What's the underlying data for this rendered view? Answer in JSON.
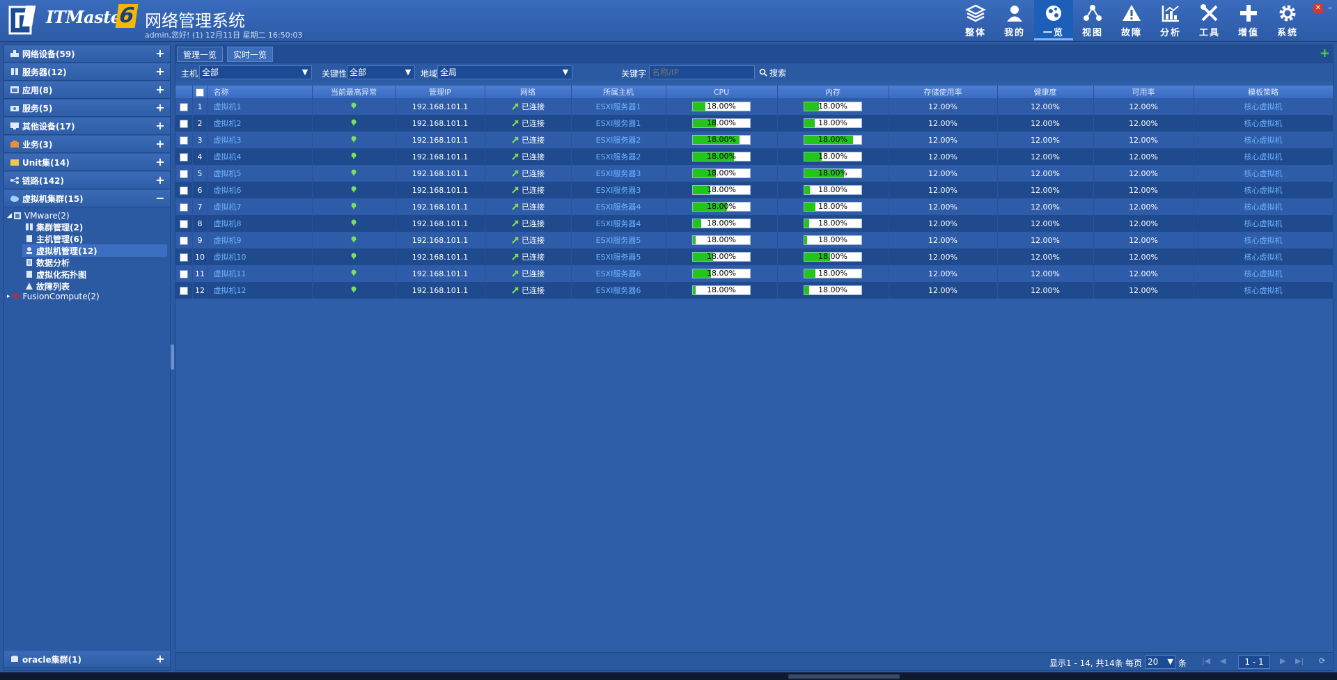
{
  "header": {
    "logo_text": "ITMaster",
    "logo_version": "6",
    "app_title": "网络管理系统",
    "welcome": "admin,您好! (1) 12月11日 星期二 16:50:03",
    "nav": [
      {
        "label": "整体",
        "icon": "layers-icon"
      },
      {
        "label": "我的",
        "icon": "user-icon"
      },
      {
        "label": "一览",
        "icon": "globe-icon",
        "active": true
      },
      {
        "label": "视图",
        "icon": "topology-icon"
      },
      {
        "label": "故障",
        "icon": "warning-icon"
      },
      {
        "label": "分析",
        "icon": "chart-icon"
      },
      {
        "label": "工具",
        "icon": "tools-icon"
      },
      {
        "label": "增值",
        "icon": "plus-icon"
      },
      {
        "label": "系统",
        "icon": "gear-icon"
      }
    ]
  },
  "sidebar": {
    "categories": [
      {
        "label": "网络设备(59)"
      },
      {
        "label": "服务器(12)"
      },
      {
        "label": "应用(8)"
      },
      {
        "label": "服务(5)"
      },
      {
        "label": "其他设备(17)"
      },
      {
        "label": "业务(3)"
      },
      {
        "label": "Unit集(14)"
      },
      {
        "label": "链路(142)"
      },
      {
        "label": "虚拟机集群(15)"
      }
    ],
    "tree": {
      "vmware": "VMware(2)",
      "children": [
        "集群管理(2)",
        "主机管理(6)",
        "虚拟机管理(12)",
        "数据分析",
        "虚拟化拓扑图",
        "故障列表"
      ],
      "fusion": "FusionCompute(2)"
    },
    "bottom_category": "oracle集群(1)"
  },
  "tabs": [
    "管理一览",
    "实时一览"
  ],
  "filters": {
    "host_label": "主机",
    "host_value": "全部",
    "key_label": "关键性",
    "key_value": "全部",
    "region_label": "地域",
    "region_value": "全局",
    "keyword_label": "关键字",
    "keyword_placeholder": "名称/IP",
    "search_label": "搜索"
  },
  "table": {
    "columns": [
      "名称",
      "当前最高异常",
      "管理IP",
      "网络",
      "所属主机",
      "CPU",
      "内存",
      "存储使用率",
      "健康度",
      "可用率",
      "模板策略"
    ],
    "rows": [
      {
        "no": "1",
        "name": "虚拟机1",
        "ip": "192.168.101.1",
        "net": "已连接",
        "host": "ESXI服务器1",
        "cpu": "18.00%",
        "cpu_fill": 0.22,
        "mem": "18.00%",
        "mem_fill": 0.25,
        "storage": "12.00%",
        "health": "12.00%",
        "avail": "12.00%",
        "policy": "核心虚拟机"
      },
      {
        "no": "2",
        "name": "虚拟机2",
        "ip": "192.168.101.1",
        "net": "已连接",
        "host": "ESXI服务器1",
        "cpu": "18.00%",
        "cpu_fill": 0.4,
        "mem": "18.00%",
        "mem_fill": 0.18,
        "storage": "12.00%",
        "health": "12.00%",
        "avail": "12.00%",
        "policy": "核心虚拟机"
      },
      {
        "no": "3",
        "name": "虚拟机3",
        "ip": "192.168.101.1",
        "net": "已连接",
        "host": "ESXI服务器2",
        "cpu": "18.00%",
        "cpu_fill": 0.82,
        "mem": "18.00%",
        "mem_fill": 0.85,
        "storage": "12.00%",
        "health": "12.00%",
        "avail": "12.00%",
        "policy": "核心虚拟机"
      },
      {
        "no": "4",
        "name": "虚拟机4",
        "ip": "192.168.101.1",
        "net": "已连接",
        "host": "ESXI服务器2",
        "cpu": "18.00%",
        "cpu_fill": 0.72,
        "mem": "18.00%",
        "mem_fill": 0.3,
        "storage": "12.00%",
        "health": "12.00%",
        "avail": "12.00%",
        "policy": "核心虚拟机"
      },
      {
        "no": "5",
        "name": "虚拟机5",
        "ip": "192.168.101.1",
        "net": "已连接",
        "host": "ESXI服务器3",
        "cpu": "18.00%",
        "cpu_fill": 0.4,
        "mem": "18.00%",
        "mem_fill": 0.7,
        "storage": "12.00%",
        "health": "12.00%",
        "avail": "12.00%",
        "policy": "核心虚拟机"
      },
      {
        "no": "6",
        "name": "虚拟机6",
        "ip": "192.168.101.1",
        "net": "已连接",
        "host": "ESXI服务器3",
        "cpu": "18.00%",
        "cpu_fill": 0.3,
        "mem": "18.00%",
        "mem_fill": 0.1,
        "storage": "12.00%",
        "health": "12.00%",
        "avail": "12.00%",
        "policy": "核心虚拟机"
      },
      {
        "no": "7",
        "name": "虚拟机7",
        "ip": "192.168.101.1",
        "net": "已连接",
        "host": "ESXI服务器4",
        "cpu": "18.00%",
        "cpu_fill": 0.6,
        "mem": "18.00%",
        "mem_fill": 0.2,
        "storage": "12.00%",
        "health": "12.00%",
        "avail": "12.00%",
        "policy": "核心虚拟机"
      },
      {
        "no": "8",
        "name": "虚拟机8",
        "ip": "192.168.101.1",
        "net": "已连接",
        "host": "ESXI服务器4",
        "cpu": "18.00%",
        "cpu_fill": 0.15,
        "mem": "18.00%",
        "mem_fill": 0.08,
        "storage": "12.00%",
        "health": "12.00%",
        "avail": "12.00%",
        "policy": "核心虚拟机"
      },
      {
        "no": "9",
        "name": "虚拟机9",
        "ip": "192.168.101.1",
        "net": "已连接",
        "host": "ESXI服务器5",
        "cpu": "18.00%",
        "cpu_fill": 0.05,
        "mem": "18.00%",
        "mem_fill": 0.05,
        "storage": "12.00%",
        "health": "12.00%",
        "avail": "12.00%",
        "policy": "核心虚拟机"
      },
      {
        "no": "10",
        "name": "虚拟机10",
        "ip": "192.168.101.1",
        "net": "已连接",
        "host": "ESXI服务器5",
        "cpu": "18.00%",
        "cpu_fill": 0.35,
        "mem": "18.00%",
        "mem_fill": 0.45,
        "storage": "12.00%",
        "health": "12.00%",
        "avail": "12.00%",
        "policy": "核心虚拟机"
      },
      {
        "no": "11",
        "name": "虚拟机11",
        "ip": "192.168.101.1",
        "net": "已连接",
        "host": "ESXI服务器6",
        "cpu": "18.00%",
        "cpu_fill": 0.32,
        "mem": "18.00%",
        "mem_fill": 0.2,
        "storage": "12.00%",
        "health": "12.00%",
        "avail": "12.00%",
        "policy": "核心虚拟机"
      },
      {
        "no": "12",
        "name": "虚拟机12",
        "ip": "192.168.101.1",
        "net": "已连接",
        "host": "ESXI服务器6",
        "cpu": "18.00%",
        "cpu_fill": 0.05,
        "mem": "18.00%",
        "mem_fill": 0.08,
        "storage": "12.00%",
        "health": "12.00%",
        "avail": "12.00%",
        "policy": "核心虚拟机"
      }
    ]
  },
  "footer": {
    "info": "显示1 - 14, 共14条",
    "per_page_label": "每页",
    "page_size": "20",
    "page_size_unit": "条",
    "page": "1 - 1"
  },
  "colors": {
    "accent": "#22c51a",
    "link": "#6fb3ff",
    "background": "#2b5aa3"
  }
}
